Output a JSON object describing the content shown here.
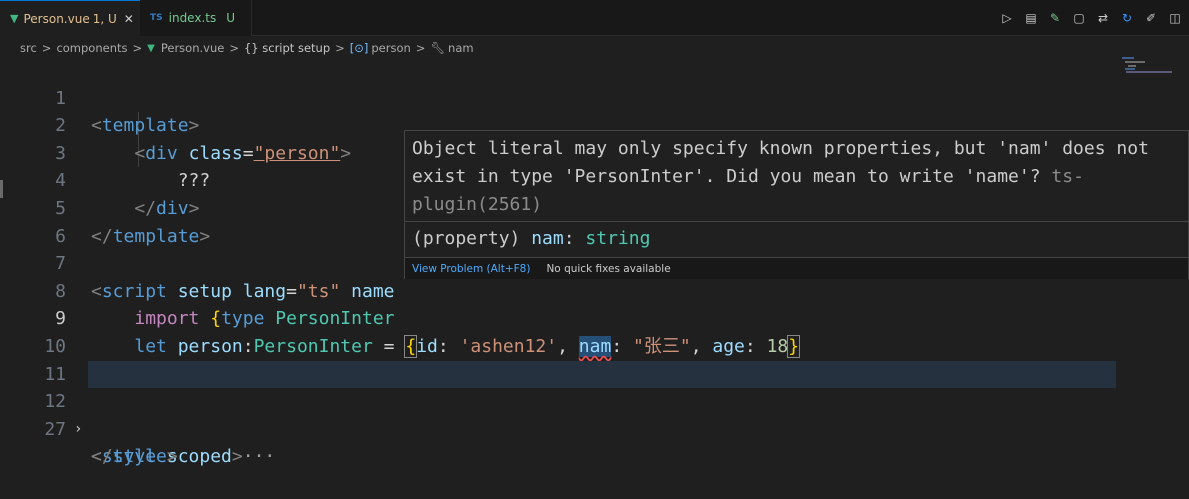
{
  "tabs": [
    {
      "label": "Person.vue",
      "badge": "1, U",
      "icon": "vue-icon",
      "active": true
    },
    {
      "label": "index.ts",
      "badge": "U",
      "icon": "ts-icon",
      "active": false
    }
  ],
  "tab_icons": {
    "vue": "▼",
    "ts": "TS",
    "close": "✕"
  },
  "breadcrumb": {
    "items": [
      "src",
      "components",
      "Person.vue",
      "{} script setup",
      "person",
      "nam"
    ],
    "separator": ">"
  },
  "toolbar_icons": [
    "run-icon",
    "split-preview-icon",
    "edit-check-icon",
    "file-icon",
    "compare-icon",
    "refresh-icon",
    "pencil-icon",
    "split-editor-icon"
  ],
  "lines": [
    {
      "n": "1"
    },
    {
      "n": "2"
    },
    {
      "n": "3"
    },
    {
      "n": "4"
    },
    {
      "n": "5"
    },
    {
      "n": "6"
    },
    {
      "n": "7"
    },
    {
      "n": "8"
    },
    {
      "n": "9"
    },
    {
      "n": "10"
    },
    {
      "n": "11"
    },
    {
      "n": "12"
    },
    {
      "n": "27"
    }
  ],
  "code": {
    "l1_tag": "template",
    "l2_tag": "div",
    "l2_attr": "class",
    "l2_val": "\"person\"",
    "l3_text": "???",
    "l4_tag": "div",
    "l5_tag": "template",
    "l7_tag": "script",
    "l7_attr1": "setup",
    "l7_attr2": "lang",
    "l7_val": "\"ts\"",
    "l7_attr3": "name",
    "l8_kw": "import",
    "l8_kw2": "type",
    "l8_type": "PersonInter",
    "l9_kw": "let",
    "l9_var": "person",
    "l9_type": "PersonInter",
    "l9_k1": "id",
    "l9_v1": "'ashen12'",
    "l9_k2": "nam",
    "l9_v2": "\"张三\"",
    "l9_k3": "age",
    "l9_v3": "18",
    "l10_tag": "script",
    "l12_tag": "style",
    "l12_attr": "scoped",
    "l12_fold": "···",
    "l27_tag": "style"
  },
  "hover": {
    "message_line1": "Object literal may only specify known properties, but 'nam' does not",
    "message_line2": "exist in type 'PersonInter'. Did you mean to write 'name'?",
    "source": "ts-",
    "source2": "plugin(2561)",
    "signature_prefix": "(property) ",
    "signature_name": "nam",
    "signature_sep": ": ",
    "signature_type": "string",
    "view_problem": "View Problem (Alt+F8)",
    "no_fixes": "No quick fixes available"
  }
}
